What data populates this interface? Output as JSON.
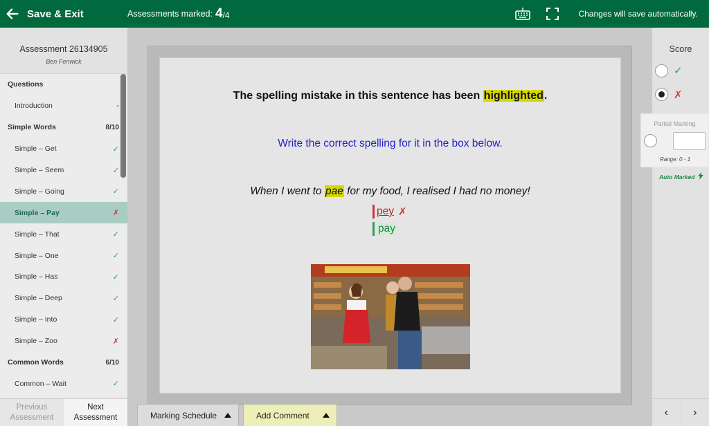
{
  "topbar": {
    "back_label": "Save & Exit",
    "marked_label": "Assessments marked:",
    "marked_count": "4",
    "marked_total": "/4",
    "autosave_text": "Changes will save automatically."
  },
  "sidebar": {
    "assessment_title": "Assessment 26134905",
    "student_name": "Ben Fenwick",
    "rows": [
      {
        "type": "section",
        "label": "Questions",
        "right": ""
      },
      {
        "type": "item",
        "label": "Introduction",
        "right": "-"
      },
      {
        "type": "section",
        "label": "Simple Words",
        "right": "8/10"
      },
      {
        "type": "item",
        "label": "Simple – Get",
        "right": "✓"
      },
      {
        "type": "item",
        "label": "Simple – Seem",
        "right": "✓"
      },
      {
        "type": "item",
        "label": "Simple – Going",
        "right": "✓"
      },
      {
        "type": "item",
        "label": "Simple – Pay",
        "right": "✗"
      },
      {
        "type": "item",
        "label": "Simple – That",
        "right": "✓"
      },
      {
        "type": "item",
        "label": "Simple – One",
        "right": "✓"
      },
      {
        "type": "item",
        "label": "Simple – Has",
        "right": "✓"
      },
      {
        "type": "item",
        "label": "Simple – Deep",
        "right": "✓"
      },
      {
        "type": "item",
        "label": "Simple – Into",
        "right": "✓"
      },
      {
        "type": "item",
        "label": "Simple – Zoo",
        "right": "✗"
      },
      {
        "type": "section",
        "label": "Common Words",
        "right": "6/10"
      },
      {
        "type": "item",
        "label": "Common – Wait",
        "right": "✓"
      }
    ],
    "prev_line1": "Previous",
    "prev_line2": "Assessment",
    "next_line1": "Next",
    "next_line2": "Assessment"
  },
  "question": {
    "line1_before": "The spelling mistake in this sentence has been ",
    "line1_highlight": "highlighted",
    "line1_after": ".",
    "line2": "Write the correct spelling for it in the box below.",
    "line3_before": "When I went to ",
    "line3_highlight": "pae",
    "line3_after": " for my food, I realised I had no money!",
    "student_answer": "pey",
    "wrong_mark": "✗",
    "correct_answer": "pay"
  },
  "bottom_tabs": {
    "schedule_label": "Marking Schedule",
    "comment_label": "Add Comment"
  },
  "score_panel": {
    "title": "Score",
    "correct_symbol": "✓",
    "wrong_symbol": "✗",
    "partial_label": "Partial Marking",
    "range_label": "Range: 0 - 1",
    "auto_label": "Auto Marked",
    "prev_arrow": "‹",
    "next_arrow": "›"
  }
}
